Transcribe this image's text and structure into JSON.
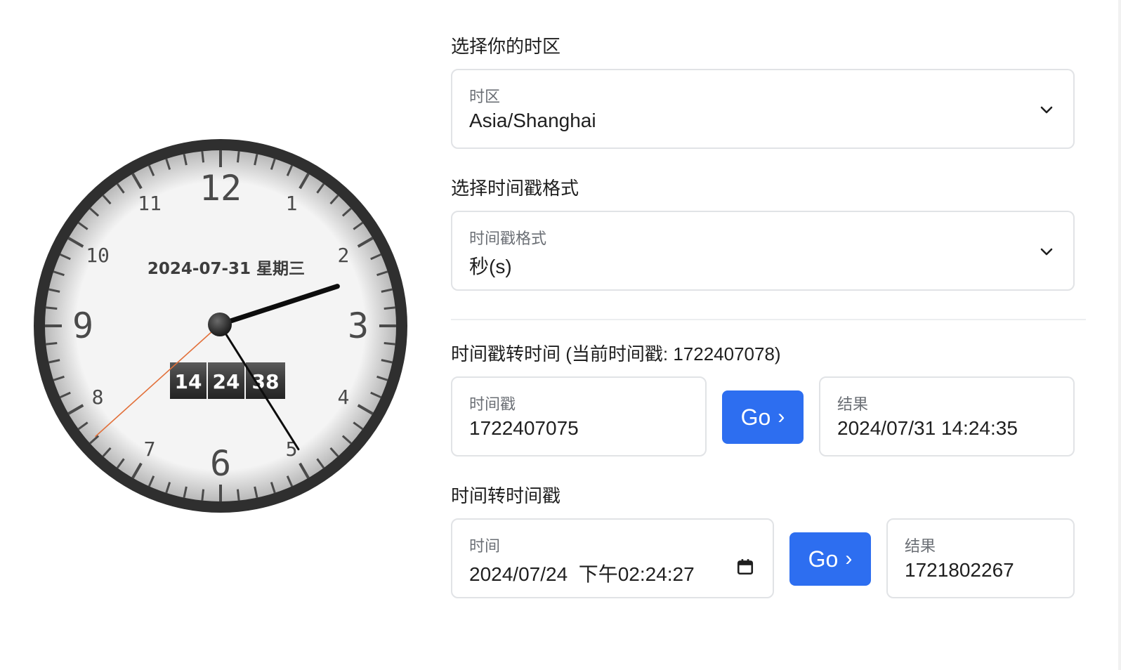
{
  "clock": {
    "date_text": "2024-07-31 星期三",
    "digital": {
      "hours": "14",
      "minutes": "24",
      "seconds": "38"
    },
    "numerals": [
      "12",
      "1",
      "2",
      "3",
      "4",
      "5",
      "6",
      "7",
      "8",
      "9",
      "10",
      "11"
    ],
    "time": {
      "hour": 14,
      "minute": 24,
      "second": 38
    },
    "colors": {
      "second_hand": "#e2703a",
      "bezel": "#2f2f2f",
      "face": "#f4f4f4"
    }
  },
  "timezone": {
    "section_title": "选择你的时区",
    "field_label": "时区",
    "value": "Asia/Shanghai"
  },
  "format": {
    "section_title": "选择时间戳格式",
    "field_label": "时间戳格式",
    "value": "秒(s)"
  },
  "ts_to_time": {
    "section_title": "时间戳转时间 (当前时间戳: 1722407078)",
    "input_label": "时间戳",
    "input_value": "1722407075",
    "go_label": "Go",
    "result_label": "结果",
    "result_value": "2024/07/31 14:24:35"
  },
  "time_to_ts": {
    "section_title": "时间转时间戳",
    "input_label": "时间",
    "input_value": "2024/07/24  下午02:24:27",
    "go_label": "Go",
    "result_label": "结果",
    "result_value": "1721802267"
  },
  "accent_color": "#2d6ef0"
}
